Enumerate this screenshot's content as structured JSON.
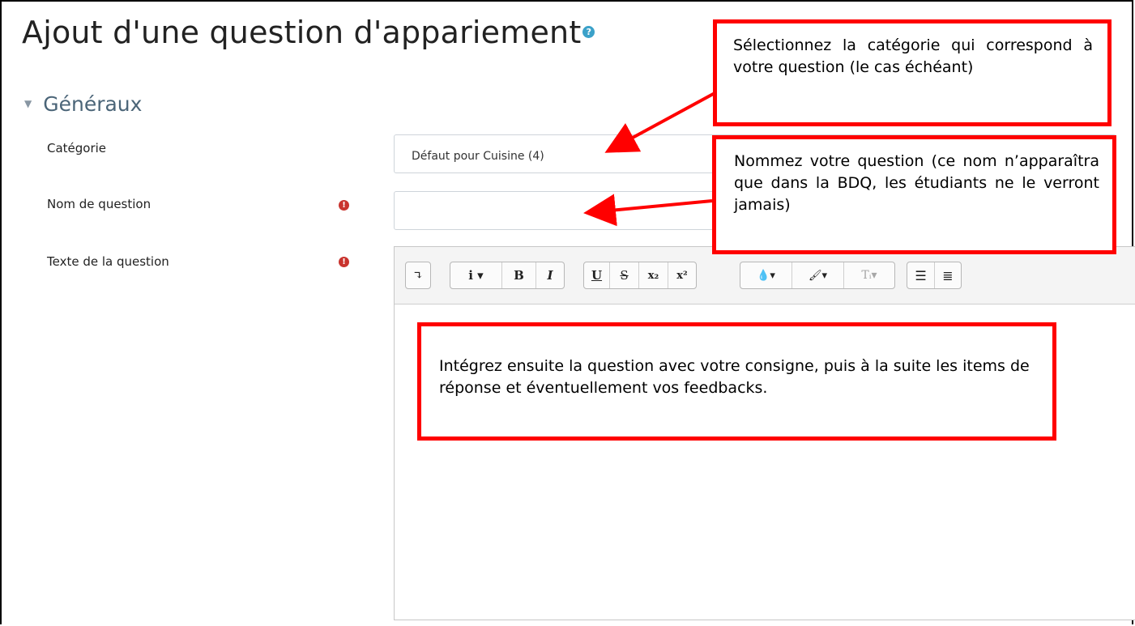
{
  "page_title": "Ajout d'une question d'appariement",
  "section": {
    "title": "Généraux"
  },
  "fields": {
    "category": {
      "label": "Catégorie",
      "value": "Défaut pour Cuisine (4)"
    },
    "question_name": {
      "label": "Nom de question",
      "value": ""
    },
    "question_text": {
      "label": "Texte de la question"
    }
  },
  "toolbar": {
    "buttons": [
      "show-more-icon",
      "italic-dropdown-icon",
      "bold-icon",
      "italic-icon",
      "underline-icon",
      "strikethrough-icon",
      "subscript-icon",
      "superscript-icon",
      "font-color-icon",
      "background-color-icon",
      "text-size-icon",
      "unordered-list-icon",
      "ordered-list-icon"
    ]
  },
  "callouts": {
    "category_hint": "Sélectionnez la catégorie qui correspond à votre question (le cas échéant)",
    "name_hint": "Nommez votre question (ce nom n’apparaîtra que dans la BDQ, les étudiants ne le verront jamais)",
    "text_hint": "Intégrez ensuite la question avec votre consigne, puis à la suite les items de réponse et éventuellement vos feedbacks."
  },
  "colors": {
    "callout_border": "#ff0000",
    "arrow": "#ff0000",
    "required": "#c9342e",
    "help": "#3ba1c9"
  }
}
